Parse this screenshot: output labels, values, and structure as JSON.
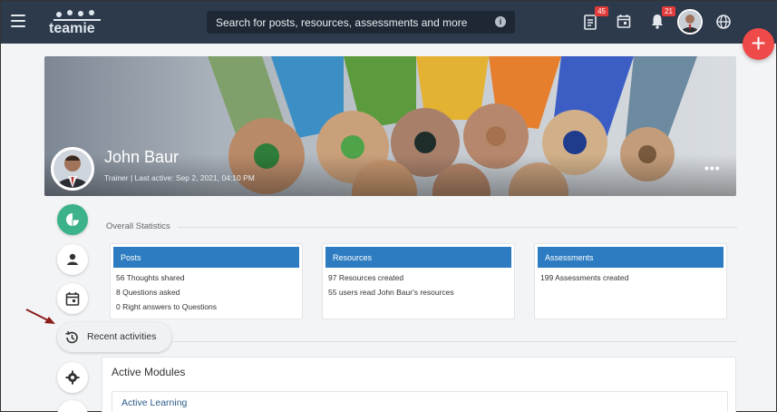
{
  "header": {
    "search_placeholder": "Search for posts, resources, assessments and more",
    "logo_text": "teamie",
    "badges": {
      "messages": "45",
      "notifications": "21"
    }
  },
  "profile": {
    "name": "John Baur",
    "meta": "Trainer | Last active: Sep 2, 2021, 04:10 PM",
    "more_icon": "•••"
  },
  "sidebar": {
    "recent_label": "Recent activities"
  },
  "overall_statistics": {
    "title": "Overall Statistics",
    "cards": [
      {
        "title": "Posts",
        "lines": [
          "56 Thoughts shared",
          "8 Questions asked",
          "0 Right answers to Questions"
        ]
      },
      {
        "title": "Resources",
        "lines": [
          "97 Resources created",
          "55 users read John Baur's resources"
        ]
      },
      {
        "title": "Assessments",
        "lines": [
          "199 Assessments created"
        ]
      }
    ]
  },
  "modules": {
    "title": "Active Modules",
    "items": [
      "Active Learning"
    ]
  },
  "fab_label": "+",
  "colors": {
    "header": "#2d3a4b",
    "accent_blue": "#2d7cc1",
    "active_green": "#3cb28a",
    "fab_red": "#ef4a4a",
    "badge_red": "#e23b3b"
  }
}
